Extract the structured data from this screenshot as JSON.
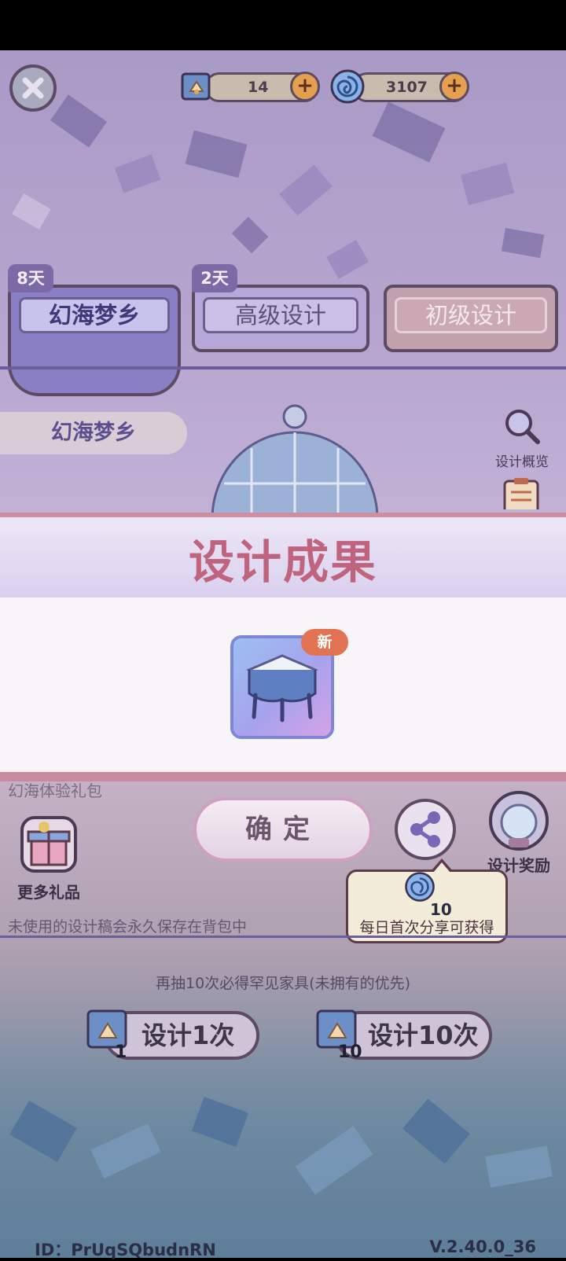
{
  "currencies": {
    "tickets": "14",
    "swirl_coins": "3107"
  },
  "tabs": [
    {
      "label": "幻海梦乡",
      "days": "8天"
    },
    {
      "label": "高级设计",
      "days": "2天"
    },
    {
      "label": "初级设计"
    }
  ],
  "side_chip": "幻海梦乡",
  "side_buttons": {
    "overview": "设计概览",
    "reward": "设计奖励",
    "more_gifts": "更多礼品"
  },
  "modal": {
    "title": "设计成果",
    "new_badge": "新"
  },
  "banner_label": "幻海体验礼包",
  "confirm_label": "确定",
  "tooltip": {
    "amount": "10",
    "text": "每日首次分享可获得"
  },
  "info_text": "未使用的设计稿会永久保存在背包中",
  "guarantee_text": "再抽10次必得罕见家具(未拥有的优先)",
  "draw": {
    "once": {
      "label": "设计1次",
      "count": "1"
    },
    "ten": {
      "label": "设计10次",
      "count": "10"
    }
  },
  "footer": {
    "id": "ID：PrUqSQbudnRN",
    "version": "V.2.40.0_36"
  },
  "colors": {
    "accent": "#c0647e",
    "plus": "#e4a04e",
    "frame": "#5d4a63"
  },
  "icons": [
    "close-icon",
    "plus-icon",
    "ticket-icon",
    "swirl-coin-icon",
    "search-icon",
    "clipboard-icon",
    "share-icon",
    "gift-icon",
    "crystal-ball-icon"
  ]
}
